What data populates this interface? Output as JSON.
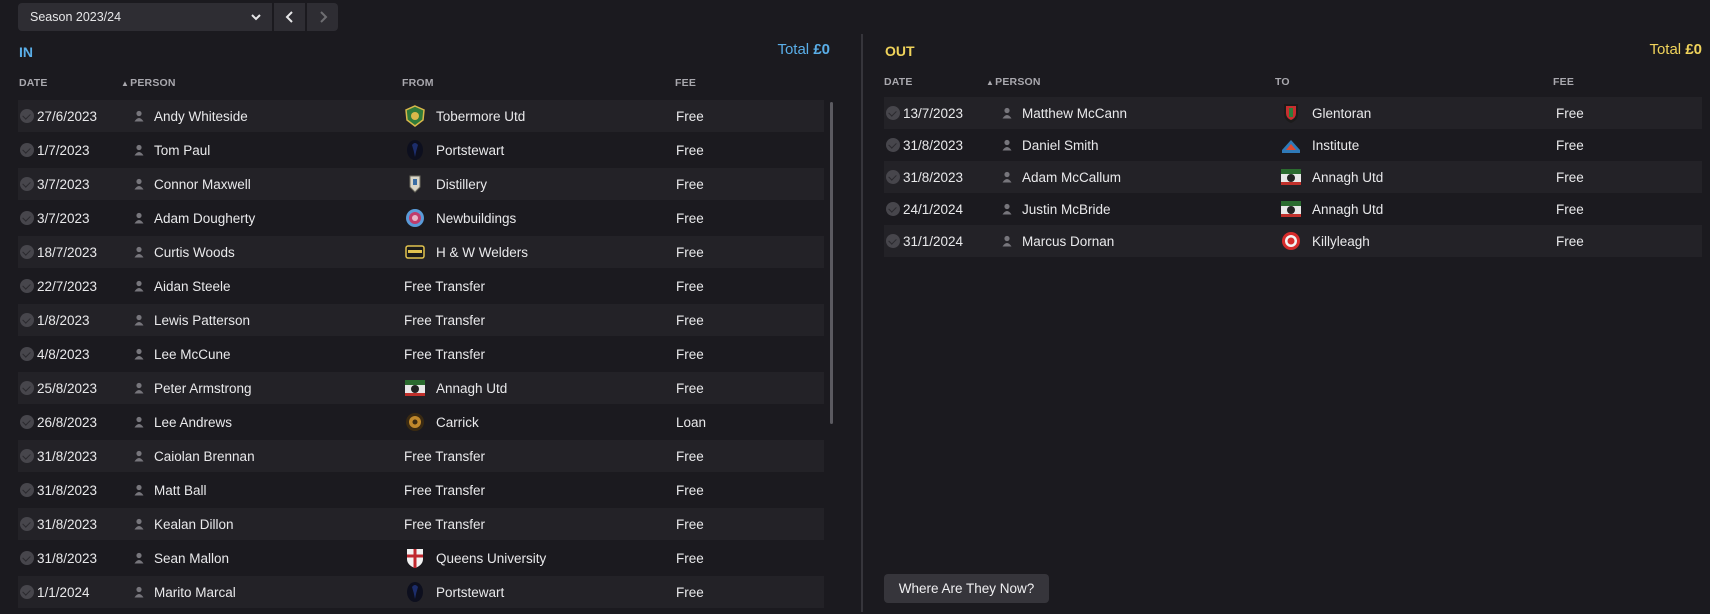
{
  "season": {
    "label": "Season 2023/24",
    "prev_icon": "chevron-left-icon",
    "next_icon": "chevron-right-icon"
  },
  "in_panel": {
    "title": "IN",
    "total_label": "Total",
    "total_value": "£0",
    "color": "#5aaee8",
    "columns": {
      "date": "DATE",
      "person": "PERSON",
      "from": "FROM",
      "fee": "FEE"
    },
    "rows": [
      {
        "date": "27/6/2023",
        "person": "Andy Whiteside",
        "club": "Tobermore Utd",
        "badge": "tobermore",
        "fee": "Free"
      },
      {
        "date": "1/7/2023",
        "person": "Tom Paul",
        "club": "Portstewart",
        "badge": "portstewart",
        "fee": "Free"
      },
      {
        "date": "3/7/2023",
        "person": "Connor Maxwell",
        "club": "Distillery",
        "badge": "distillery",
        "fee": "Free"
      },
      {
        "date": "3/7/2023",
        "person": "Adam Dougherty",
        "club": "Newbuildings",
        "badge": "newbuildings",
        "fee": "Free"
      },
      {
        "date": "18/7/2023",
        "person": "Curtis Woods",
        "club": "H & W Welders",
        "badge": "welders",
        "fee": "Free"
      },
      {
        "date": "22/7/2023",
        "person": "Aidan Steele",
        "club": "Free Transfer",
        "badge": "",
        "fee": "Free"
      },
      {
        "date": "1/8/2023",
        "person": "Lewis Patterson",
        "club": "Free Transfer",
        "badge": "",
        "fee": "Free"
      },
      {
        "date": "4/8/2023",
        "person": "Lee McCune",
        "club": "Free Transfer",
        "badge": "",
        "fee": "Free"
      },
      {
        "date": "25/8/2023",
        "person": "Peter Armstrong",
        "club": "Annagh Utd",
        "badge": "annagh",
        "fee": "Free"
      },
      {
        "date": "26/8/2023",
        "person": "Lee Andrews",
        "club": "Carrick",
        "badge": "carrick",
        "fee": "Loan"
      },
      {
        "date": "31/8/2023",
        "person": "Caiolan Brennan",
        "club": "Free Transfer",
        "badge": "",
        "fee": "Free"
      },
      {
        "date": "31/8/2023",
        "person": "Matt Ball",
        "club": "Free Transfer",
        "badge": "",
        "fee": "Free"
      },
      {
        "date": "31/8/2023",
        "person": "Kealan Dillon",
        "club": "Free Transfer",
        "badge": "",
        "fee": "Free"
      },
      {
        "date": "31/8/2023",
        "person": "Sean Mallon",
        "club": "Queens University",
        "badge": "queens",
        "fee": "Free"
      },
      {
        "date": "1/1/2024",
        "person": "Marito Marcal",
        "club": "Portstewart",
        "badge": "portstewart",
        "fee": "Free"
      }
    ]
  },
  "out_panel": {
    "title": "OUT",
    "total_label": "Total",
    "total_value": "£0",
    "color": "#f0d35b",
    "columns": {
      "date": "DATE",
      "person": "PERSON",
      "to": "TO",
      "fee": "FEE"
    },
    "rows": [
      {
        "date": "13/7/2023",
        "person": "Matthew McCann",
        "club": "Glentoran",
        "badge": "glentoran",
        "fee": "Free"
      },
      {
        "date": "31/8/2023",
        "person": "Daniel Smith",
        "club": "Institute",
        "badge": "institute",
        "fee": "Free"
      },
      {
        "date": "31/8/2023",
        "person": "Adam McCallum",
        "club": "Annagh Utd",
        "badge": "annagh",
        "fee": "Free"
      },
      {
        "date": "24/1/2024",
        "person": "Justin McBride",
        "club": "Annagh Utd",
        "badge": "annagh",
        "fee": "Free"
      },
      {
        "date": "31/1/2024",
        "person": "Marcus Dornan",
        "club": "Killyleagh",
        "badge": "killyleagh",
        "fee": "Free"
      }
    ]
  },
  "where_button": {
    "label": "Where Are They Now?"
  }
}
